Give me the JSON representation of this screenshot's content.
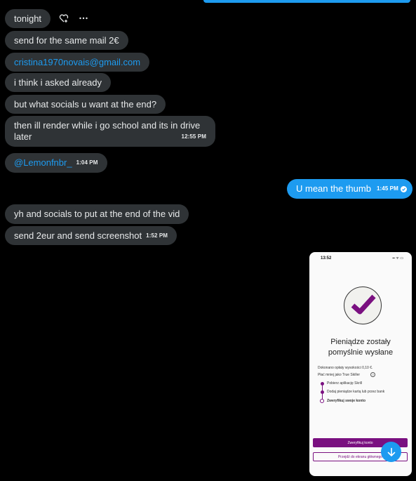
{
  "messages": {
    "tonight": "tonight",
    "same_mail": "send for the same mail 2€",
    "email": "cristina1970novais@gmail.com",
    "asked": "i think i asked already",
    "socials_q": "but what socials u want at the end?",
    "render_line1": "then ill render while i go school and its in drive",
    "render_line2": "later",
    "render_time": "12:55 PM",
    "mention": "@Lemonfnbr_",
    "mention_time": "1:04 PM",
    "thumb": "U mean the thumb",
    "thumb_time": "1:45 PM",
    "yh_socials": "yh and socials to put at the end of the vid",
    "send_2eur": "send 2eur and send screenshot",
    "send_2eur_time": "1:52 PM"
  },
  "phone": {
    "time": "13:52",
    "status_icons": "▪▪ ᯤ ▭",
    "title_line1": "Pieniądze zostały",
    "title_line2": "pomyślnie wysłane",
    "fee_line": "Dokonano opłaty wysokości 0,10 €.",
    "pay_less": "Płać mniej jako True Skiller",
    "step1": "Pobierz aplikację Skrill",
    "step2": "Dodaj pieniądze kartą lub przez bank",
    "step3": "Zweryfikuj swoje konto",
    "btn_primary": "Zweryfikuj konto",
    "btn_secondary": "Przejdź do ekranu głównego"
  },
  "icons": {
    "react": "heart-plus-icon",
    "more": "more-icon",
    "read": "check-circle-icon",
    "scroll": "arrow-down-icon"
  },
  "colors": {
    "accent": "#1d9bf0",
    "bubble_in": "#2f3336",
    "skrill_purple": "#7a1080"
  }
}
